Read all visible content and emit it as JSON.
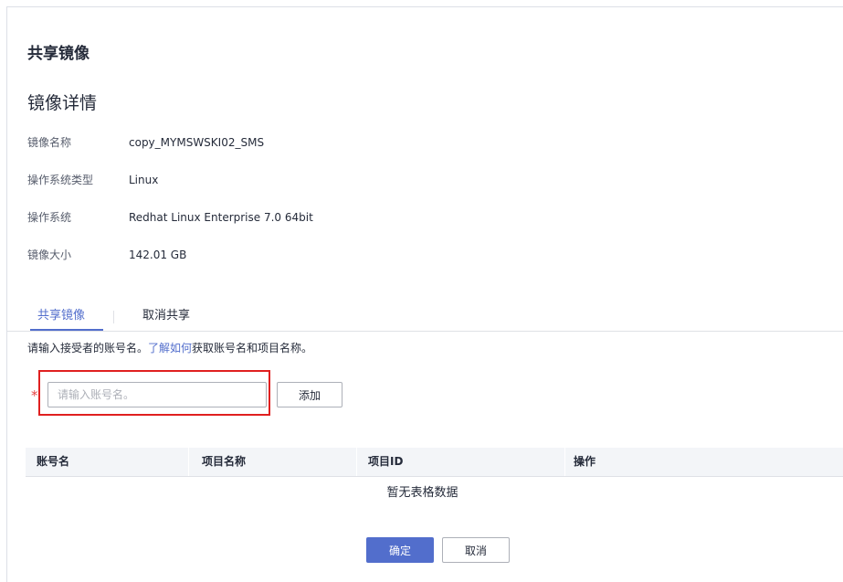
{
  "dialog": {
    "title": "共享镜像"
  },
  "details": {
    "section_title": "镜像详情",
    "rows": [
      {
        "label": "镜像名称",
        "value": "copy_MYMSWSKI02_SMS"
      },
      {
        "label": "操作系统类型",
        "value": "Linux"
      },
      {
        "label": "操作系统",
        "value": "Redhat Linux Enterprise 7.0 64bit"
      },
      {
        "label": "镜像大小",
        "value": "142.01 GB"
      }
    ]
  },
  "tabs": [
    {
      "label": "共享镜像",
      "active": true
    },
    {
      "label": "取消共享",
      "active": false
    }
  ],
  "hint": {
    "prefix": "请输入接受者的账号名。",
    "link": "了解如何",
    "suffix": "获取账号名和项目名称。"
  },
  "account_input": {
    "required_mark": "*",
    "placeholder": "请输入账号名。",
    "value": ""
  },
  "add_button": {
    "label": "添加"
  },
  "table": {
    "columns": [
      "账号名",
      "项目名称",
      "项目ID",
      "操作"
    ],
    "rows": [],
    "empty_text": "暂无表格数据"
  },
  "footer": {
    "confirm_label": "确定",
    "cancel_label": "取消"
  },
  "colors": {
    "accent": "#526ecc",
    "highlight_border": "#e02020",
    "required": "#e54545",
    "table_header_bg": "#f3f5f8"
  }
}
